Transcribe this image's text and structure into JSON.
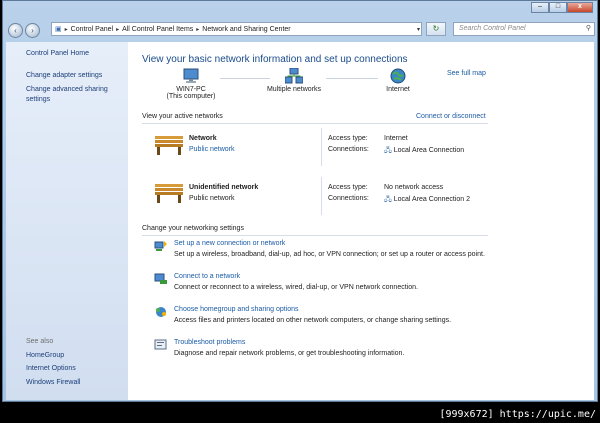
{
  "caption": {
    "minimize": "–",
    "maximize": "□",
    "close": "x"
  },
  "address": {
    "crumbs": [
      "Control Panel",
      "All Control Panel Items",
      "Network and Sharing Center"
    ],
    "search_placeholder": "Search Control Panel"
  },
  "sidebar": {
    "links": [
      "Control Panel Home",
      "Change adapter settings",
      "Change advanced sharing settings"
    ],
    "see_also_label": "See also",
    "see_also": [
      "HomeGroup",
      "Internet Options",
      "Windows Firewall"
    ]
  },
  "main": {
    "title": "View your basic network information and set up connections",
    "see_full_map": "See full map",
    "map": [
      {
        "label": "WIN7-PC",
        "sub": "(This computer)"
      },
      {
        "label": "Multiple networks",
        "sub": ""
      },
      {
        "label": "Internet",
        "sub": ""
      }
    ],
    "active_title": "View your active networks",
    "connect_disconnect": "Connect or disconnect",
    "networks": [
      {
        "name": "Network",
        "category": "Public network",
        "category_is_link": true,
        "access_label": "Access type:",
        "access": "Internet",
        "conn_label": "Connections:",
        "conn": "Local Area Connection"
      },
      {
        "name": "Unidentified network",
        "category": "Public network",
        "category_is_link": false,
        "access_label": "Access type:",
        "access": "No network access",
        "conn_label": "Connections:",
        "conn": "Local Area Connection 2"
      }
    ],
    "settings_title": "Change your networking settings",
    "tasks": [
      {
        "title": "Set up a new connection or network",
        "desc": "Set up a wireless, broadband, dial-up, ad hoc, or VPN connection; or set up a router or access point."
      },
      {
        "title": "Connect to a network",
        "desc": "Connect or reconnect to a wireless, wired, dial-up, or VPN network connection."
      },
      {
        "title": "Choose homegroup and sharing options",
        "desc": "Access files and printers located on other network computers, or change sharing settings."
      },
      {
        "title": "Troubleshoot problems",
        "desc": "Diagnose and repair network problems, or get troubleshooting information."
      }
    ]
  },
  "watermark": "[999x672] https://upic.me/"
}
